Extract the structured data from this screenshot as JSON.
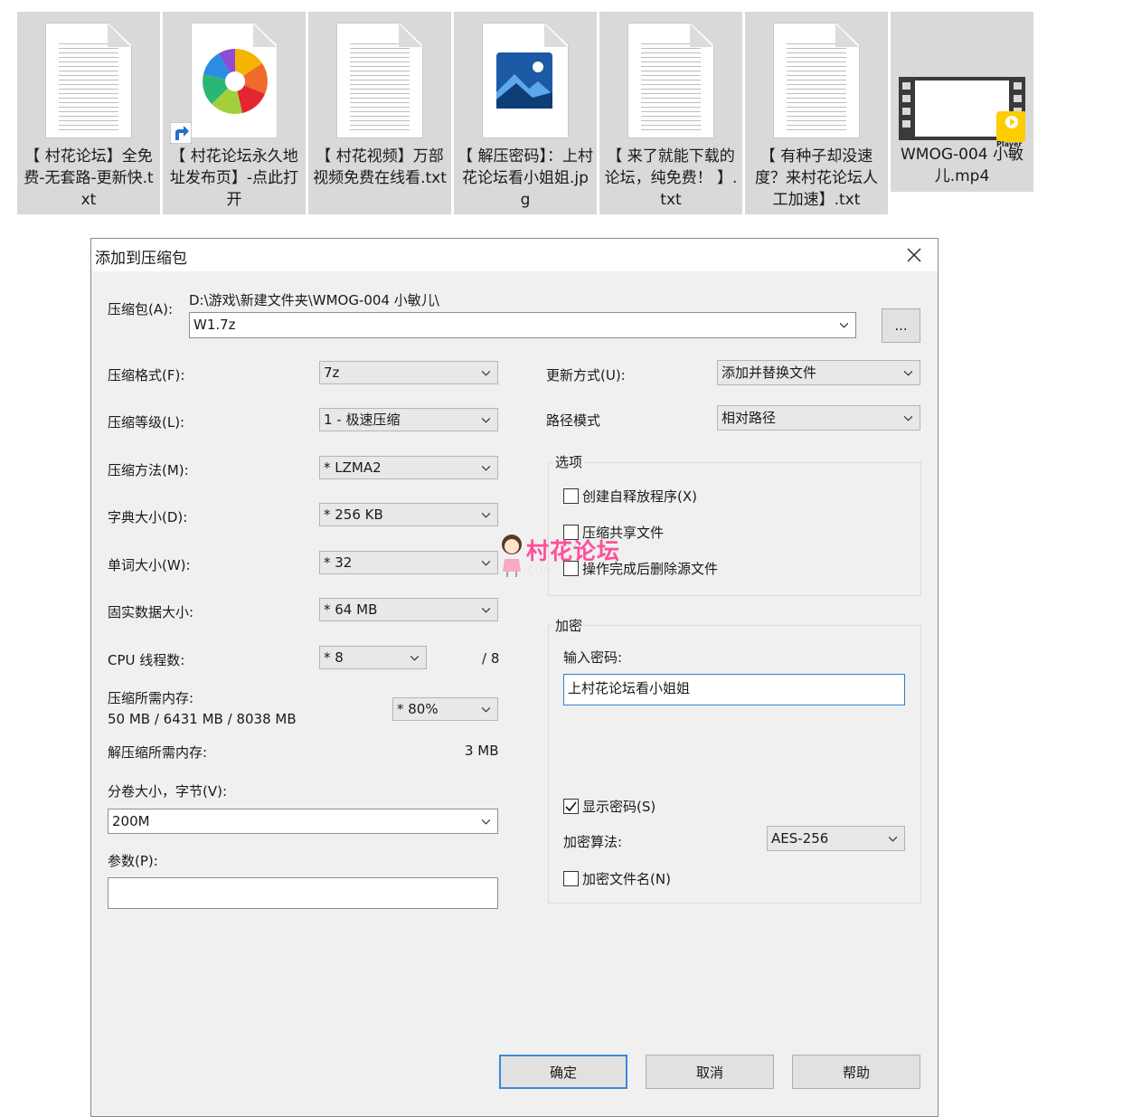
{
  "files": [
    {
      "name": "【 村花论坛】全免费-无套路-更新快.txt",
      "type": "txt"
    },
    {
      "name": "【 村花论坛永久地址发布页】-点此打开",
      "type": "shortcut"
    },
    {
      "name": "【 村花视频】万部视频免费在线看.txt",
      "type": "txt"
    },
    {
      "name": "【 解压密码】：上村花论坛看小姐姐.jpg",
      "type": "image"
    },
    {
      "name": "【 来了就能下载的论坛，纯免费！ 】.txt",
      "type": "txt"
    },
    {
      "name": "【 有种子却没速度？来村花论坛人工加速】.txt",
      "type": "txt"
    },
    {
      "name": "WMOG-004 小敏儿.mp4",
      "type": "video",
      "badge": "Player"
    }
  ],
  "dialog": {
    "title": "添加到压缩包",
    "archive_label": "压缩包(A):",
    "archive_path": "D:\\游戏\\新建文件夹\\WMOG-004 小敏儿\\",
    "archive_name": "W1.7z",
    "browse_label": "...",
    "format_label": "压缩格式(F):",
    "format_value": "7z",
    "level_label": "压缩等级(L):",
    "level_value": "1 - 极速压缩",
    "method_label": "压缩方法(M):",
    "method_value": "*  LZMA2",
    "dict_label": "字典大小(D):",
    "dict_value": "*  256 KB",
    "word_label": "单词大小(W):",
    "word_value": "*  32",
    "solid_label": "固实数据大小:",
    "solid_value": "*  64 MB",
    "threads_label": "CPU 线程数:",
    "threads_value": "*  8",
    "threads_total": "/ 8",
    "mem_comp_label": "压缩所需内存:",
    "mem_comp_value": "50 MB / 6431 MB / 8038 MB",
    "mem_percent": "* 80%",
    "mem_decomp_label": "解压缩所需内存:",
    "mem_decomp_value": "3 MB",
    "volume_label": "分卷大小，字节(V):",
    "volume_value": "200M",
    "params_label": "参数(P):",
    "params_value": "",
    "update_label": "更新方式(U):",
    "update_value": "添加并替换文件",
    "path_label": "路径模式",
    "path_value": "相对路径",
    "options_title": "选项",
    "opt_sfx": "创建自释放程序(X)",
    "opt_shared": "压缩共享文件",
    "opt_delete": "操作完成后删除源文件",
    "encrypt_title": "加密",
    "password_label": "输入密码:",
    "password_value": "上村花论坛看小姐姐",
    "show_password": "显示密码(S)",
    "algo_label": "加密算法:",
    "algo_value": "AES-256",
    "encrypt_names": "加密文件名(N)",
    "ok": "确定",
    "cancel": "取消",
    "help": "帮助"
  },
  "watermark": {
    "text": "村花论坛",
    "sub": "cun"
  },
  "colors": {
    "accent": "#3a8ad8",
    "watermark": "#ff4f9a"
  }
}
